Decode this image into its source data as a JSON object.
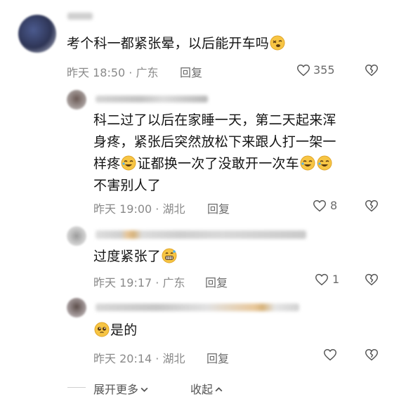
{
  "comments": [
    {
      "text": "考个科一都紧张晕，以后能开车吗",
      "time": "昨天 18:50 · 广东",
      "reply": "回复",
      "likes": "355"
    }
  ],
  "replies": [
    {
      "lines": [
        "科二过了以后在家睡一天，第二天起来浑",
        "身疼，紧张后突然放松下来跟人打一架一",
        "样疼",
        "证都换一次了没敢开一次车",
        "不害别人了"
      ],
      "time": "昨天 19:00 · 湖北",
      "reply": "回复",
      "likes": "8"
    },
    {
      "text": "过度紧张了",
      "time": "昨天 19:17 · 广东",
      "reply": "回复",
      "likes": "1"
    },
    {
      "text": "是的",
      "time": "昨天 20:14 · 湖北",
      "reply": "回复",
      "likes": ""
    }
  ],
  "footer": {
    "expand": "展开更多",
    "collapse": "收起"
  },
  "colors": {
    "text": "#141414",
    "meta": "#8a8a8a",
    "emoji": "#f7c544"
  }
}
